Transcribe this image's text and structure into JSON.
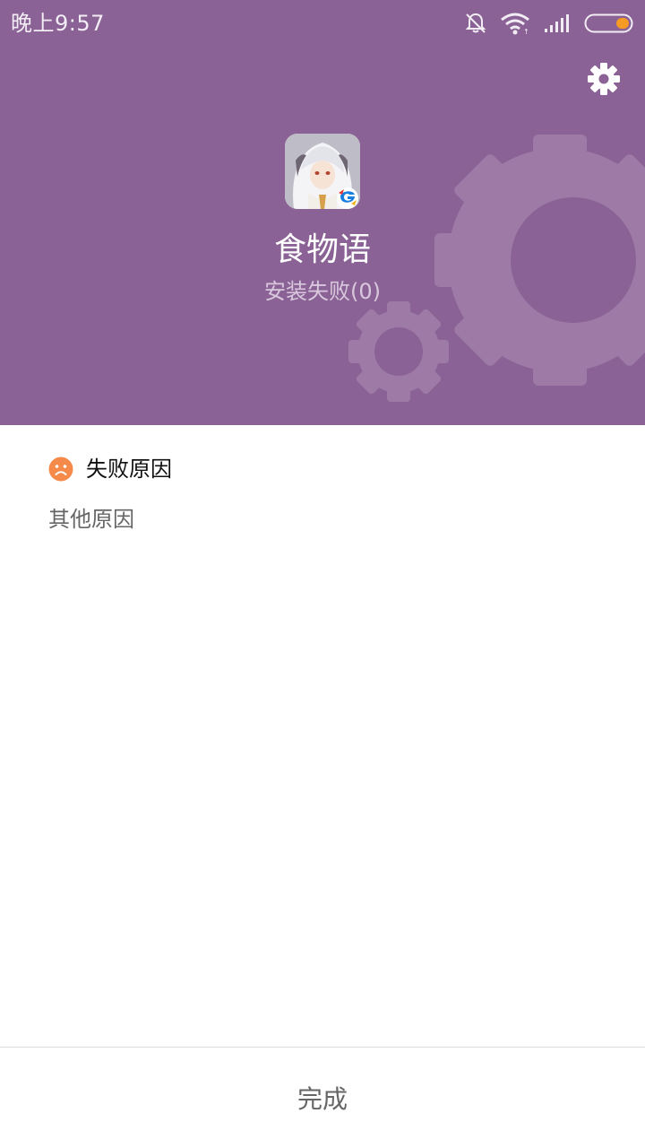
{
  "status_bar": {
    "time": "晚上9:57",
    "icons": [
      "bell-off-icon",
      "wifi-icon",
      "signal-icon",
      "battery-icon"
    ],
    "battery_color": "#f59a23"
  },
  "header": {
    "background_color": "#8a6295",
    "settings_icon": "gear-icon",
    "app_icon": "app-icon",
    "app_name": "食物语",
    "install_status": "安装失败(0)"
  },
  "failure": {
    "icon": "sad-face-icon",
    "icon_color": "#f58a4b",
    "title": "失败原因",
    "reason": "其他原因"
  },
  "footer": {
    "done_label": "完成"
  }
}
